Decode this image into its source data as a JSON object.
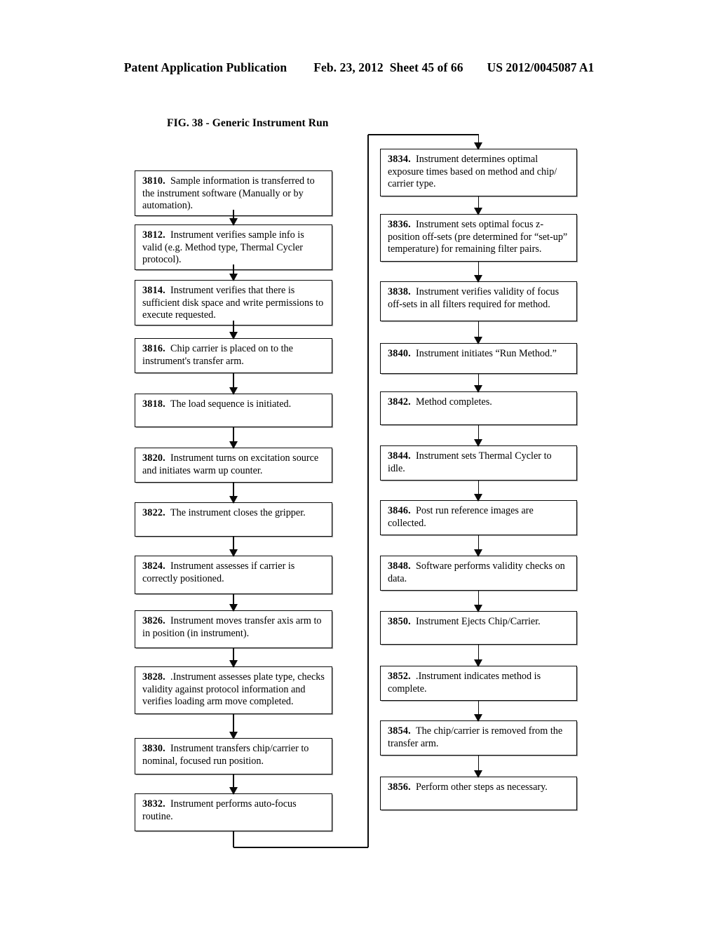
{
  "header": {
    "publication": "Patent Application Publication",
    "date": "Feb. 23, 2012",
    "sheet": "Sheet 45 of 66",
    "patent_number": "US 2012/0045087 A1"
  },
  "figure": {
    "title": "FIG. 38 - Generic Instrument Run"
  },
  "flowchart": {
    "left_column": [
      {
        "num": "3810.",
        "text": "Sample information is transferred to the instrument software (Manually or by automation)."
      },
      {
        "num": "3812.",
        "text": "Instrument verifies sample info is valid (e.g. Method type, Thermal Cycler protocol)."
      },
      {
        "num": "3814.",
        "text": "Instrument verifies that there is sufficient disk space and write permissions to execute requested."
      },
      {
        "num": "3816.",
        "text": "Chip carrier is placed on to the instrument's transfer arm."
      },
      {
        "num": "3818.",
        "text": "The load sequence is initiated."
      },
      {
        "num": "3820.",
        "text": "Instrument turns on excitation source and initiates warm up counter."
      },
      {
        "num": "3822.",
        "text": "The instrument closes the gripper."
      },
      {
        "num": "3824.",
        "text": "Instrument assesses if carrier is correctly positioned."
      },
      {
        "num": "3826.",
        "text": "Instrument moves transfer axis arm to in position (in instrument)."
      },
      {
        "num": "3828.",
        "text": ".Instrument assesses plate type, checks validity against protocol information and verifies loading arm move completed."
      },
      {
        "num": "3830.",
        "text": "Instrument transfers chip/carrier to nominal, focused run position."
      },
      {
        "num": "3832.",
        "text": "Instrument performs auto-focus routine."
      }
    ],
    "right_column": [
      {
        "num": "3834.",
        "text": "Instrument determines optimal exposure times based on method and chip/ carrier type."
      },
      {
        "num": "3836.",
        "text": "Instrument sets optimal focus z-position off-sets (pre determined for “set-up” temperature) for remaining filter pairs."
      },
      {
        "num": "3838.",
        "text": "Instrument verifies validity of focus off-sets in all filters required for method."
      },
      {
        "num": "3840.",
        "text": "Instrument initiates “Run Method.”"
      },
      {
        "num": "3842.",
        "text": "Method completes."
      },
      {
        "num": "3844.",
        "text": "Instrument sets Thermal Cycler to idle."
      },
      {
        "num": "3846.",
        "text": "Post run reference images are collected."
      },
      {
        "num": "3848.",
        "text": "Software performs validity checks on data."
      },
      {
        "num": "3850.",
        "text": "Instrument Ejects Chip/Carrier."
      },
      {
        "num": "3852.",
        "text": ".Instrument indicates method is complete."
      },
      {
        "num": "3854.",
        "text": "The chip/carrier is removed from the transfer arm."
      },
      {
        "num": "3856.",
        "text": "Perform other steps as necessary."
      }
    ]
  }
}
